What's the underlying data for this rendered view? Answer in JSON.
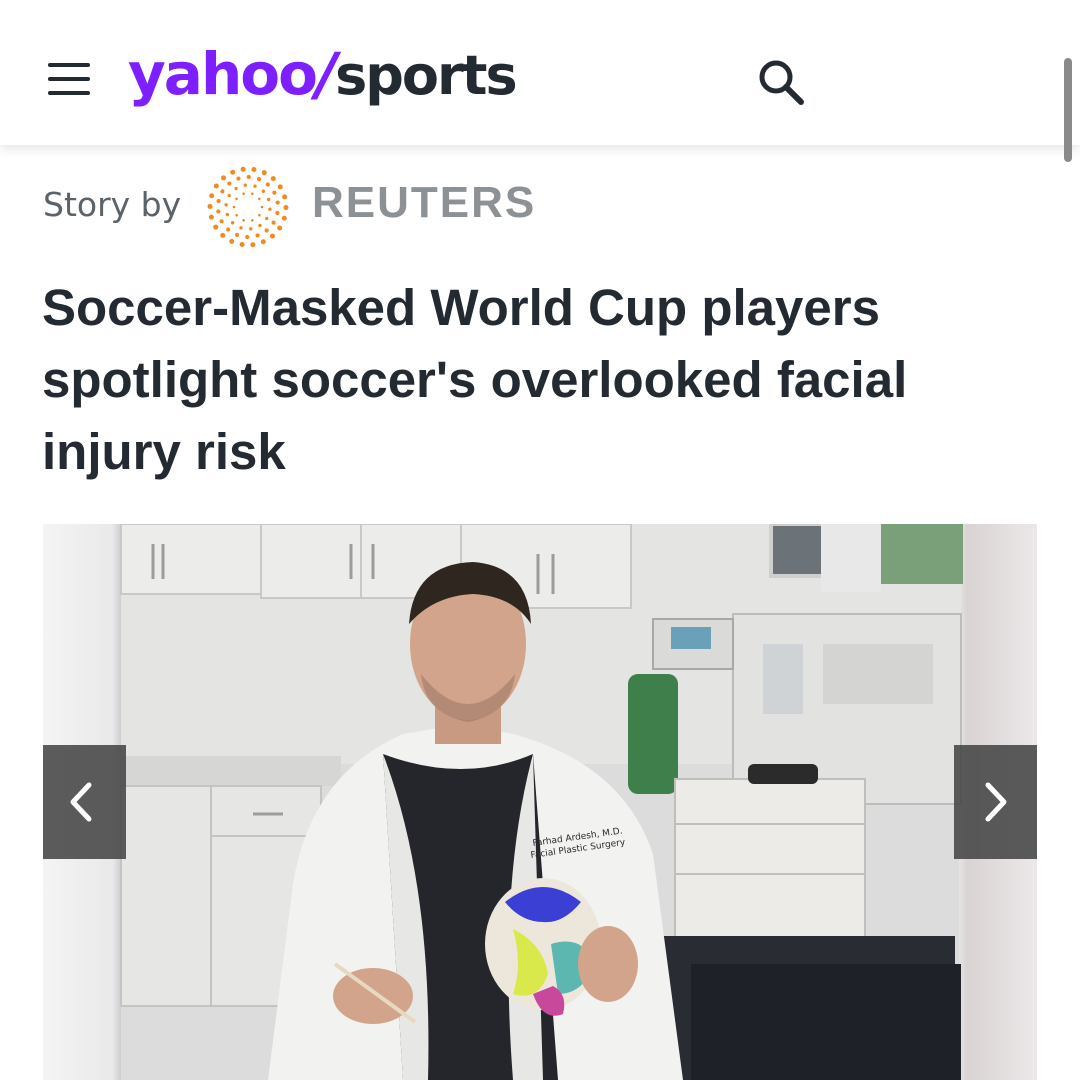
{
  "header": {
    "menu_icon": "hamburger-menu-icon",
    "logo": {
      "brand": "yahoo",
      "slash": "/",
      "section": "sports"
    },
    "search_icon": "search-icon"
  },
  "byline": {
    "prefix": "Story by",
    "source_logo_icon": "reuters-dots-icon",
    "source": "REUTERS"
  },
  "article": {
    "headline": "Soccer-Masked World Cup players spotlight soccer's overlooked facial injury risk"
  },
  "gallery": {
    "prev_icon": "chevron-left-icon",
    "next_icon": "chevron-right-icon",
    "coat_text_line1": "Farhad Ardesh, M.D.",
    "coat_text_line2": "Facial Plastic Surgery"
  },
  "colors": {
    "brand_purple": "#7e1fff",
    "text_dark": "#232a31",
    "byline_gray": "#5b636a",
    "reuters_orange": "#f28a1e"
  }
}
